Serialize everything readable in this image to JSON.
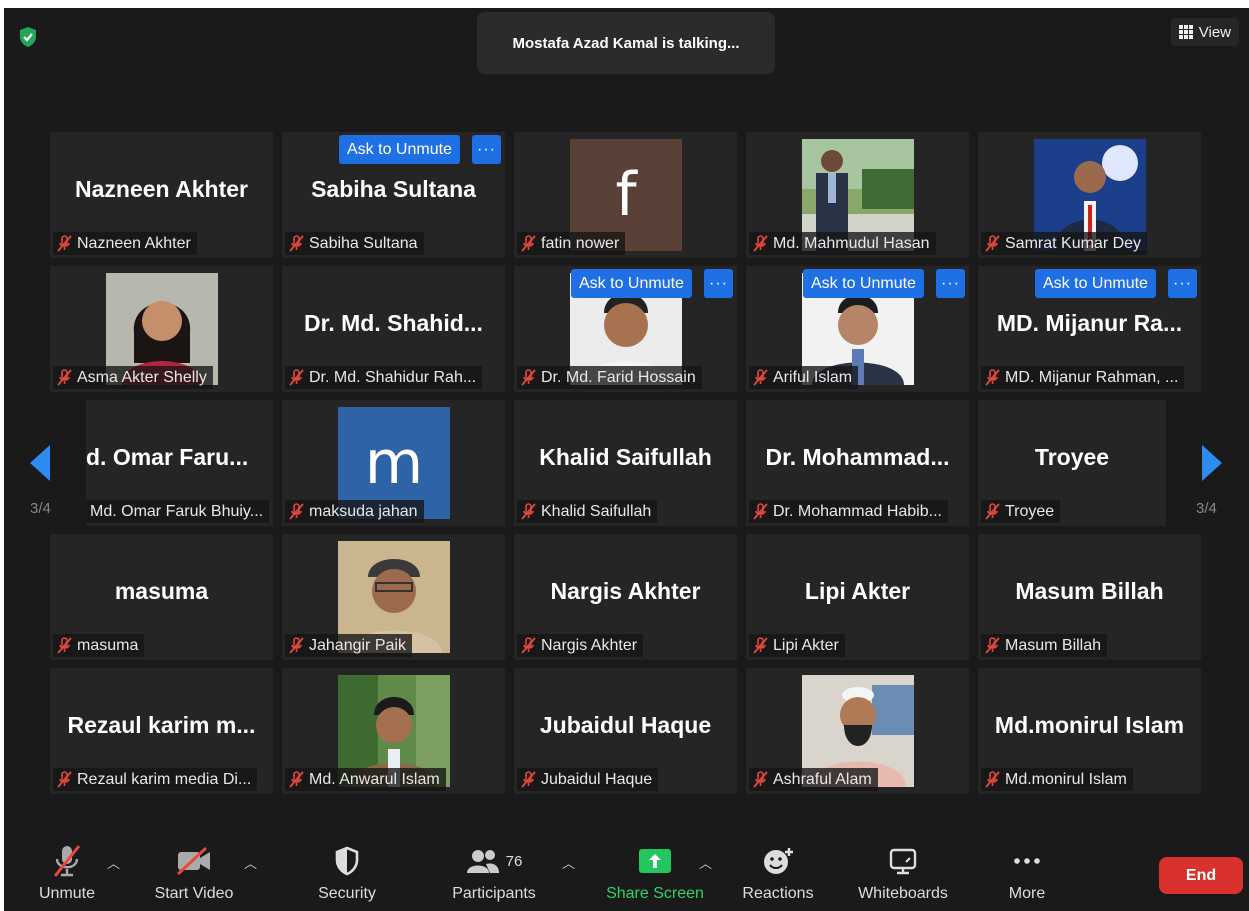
{
  "header": {
    "talking": "Mostafa Azad Kamal is talking...",
    "view_label": "View"
  },
  "pager": {
    "left": "3/4",
    "right": "3/4"
  },
  "tiles": [
    {
      "big": "Nazneen Akhter",
      "label": "Nazneen Akhter"
    },
    {
      "big": "Sabiha Sultana",
      "label": "Sabiha Sultana"
    },
    {
      "initial": "f",
      "label": "fatin nower"
    },
    {
      "label": "Md. Mahmudul Hasan"
    },
    {
      "label": "Samrat Kumar Dey"
    },
    {
      "label": "Asma Akter Shelly"
    },
    {
      "big": "Dr. Md. Shahid...",
      "label": "Dr. Md. Shahidur Rah..."
    },
    {
      "label": "Dr. Md. Farid Hossain"
    },
    {
      "label": "Ariful Islam"
    },
    {
      "big": "MD. Mijanur Ra...",
      "label": "MD. Mijanur Rahman, ..."
    },
    {
      "big": "d. Omar Faru...",
      "label": "Md. Omar Faruk Bhuiy..."
    },
    {
      "initial": "m",
      "label": "maksuda jahan"
    },
    {
      "big": "Khalid Saifullah",
      "label": "Khalid Saifullah"
    },
    {
      "big": "Dr. Mohammad...",
      "label": "Dr. Mohammad Habib..."
    },
    {
      "big": "Troyee",
      "label": "Troyee"
    },
    {
      "big": "masuma",
      "label": "masuma"
    },
    {
      "label": "Jahangir Paik"
    },
    {
      "big": "Nargis Akhter",
      "label": "Nargis Akhter"
    },
    {
      "big": "Lipi Akter",
      "label": "Lipi Akter"
    },
    {
      "big": "Masum Billah",
      "label": "Masum Billah"
    },
    {
      "big": "Rezaul karim m...",
      "label": "Rezaul karim media Di..."
    },
    {
      "label": "Md. Anwarul Islam"
    },
    {
      "big": "Jubaidul Haque",
      "label": "Jubaidul Haque"
    },
    {
      "label": "Ashraful Alam"
    },
    {
      "big": "Md.monirul Islam",
      "label": "Md.monirul Islam"
    }
  ],
  "tile_menu": {
    "ask_to_unmute": "Ask to Unmute",
    "more": "···"
  },
  "toolbar": {
    "unmute": "Unmute",
    "start_video": "Start Video",
    "security": "Security",
    "participants": "Participants",
    "participants_count": "76",
    "share_screen": "Share Screen",
    "reactions": "Reactions",
    "whiteboards": "Whiteboards",
    "more": "More",
    "end": "End"
  },
  "colors": {
    "background": "#1a1a1a",
    "tile": "#252525",
    "ask_button": "#1f6fe5",
    "share_green": "#22c55e",
    "end_red": "#d9322e",
    "shield_green": "#23a55a",
    "arrow_blue": "#2d8cf0"
  }
}
